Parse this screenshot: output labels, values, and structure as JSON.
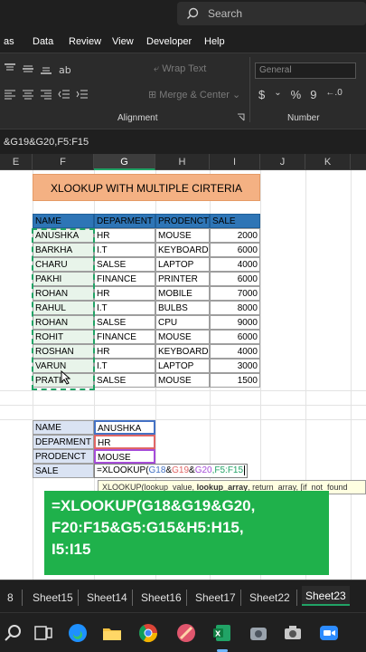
{
  "titlebar": {
    "search_placeholder": "Search"
  },
  "menu": [
    "as",
    "Data",
    "Review",
    "View",
    "Developer",
    "Help"
  ],
  "ribbon": {
    "wrap_text": "Wrap Text",
    "merge_center": "Merge & Center",
    "number_format": "General",
    "alignment_label": "Alignment",
    "number_label": "Number"
  },
  "formula_bar": {
    "text": "&G19&G20,F5:F15"
  },
  "columns": [
    "E",
    "F",
    "G",
    "H",
    "I",
    "J",
    "K"
  ],
  "active_column": "G",
  "sheet": {
    "title": "XLOOKUP WITH MULTIPLE CIRTERIA",
    "headers": [
      "NAME",
      "DEPARMENT",
      "PRODENCT",
      "SALE"
    ],
    "rows": [
      [
        "ANUSHKA",
        "HR",
        "MOUSE",
        "2000"
      ],
      [
        "BARKHA",
        "I.T",
        "KEYBOARD",
        "6000"
      ],
      [
        "CHARU",
        "SALSE",
        "LAPTOP",
        "4000"
      ],
      [
        "PAKHI",
        "FINANCE",
        "PRINTER",
        "6000"
      ],
      [
        "ROHAN",
        "HR",
        "MOBILE",
        "7000"
      ],
      [
        "RAHUL",
        "I.T",
        "BULBS",
        "8000"
      ],
      [
        "ROHAN",
        "SALSE",
        "CPU",
        "9000"
      ],
      [
        "ROHIT",
        "FINANCE",
        "MOUSE",
        "6000"
      ],
      [
        "ROSHAN",
        "HR",
        "KEYBOARD",
        "4000"
      ],
      [
        "VARUN",
        "I.T",
        "LAPTOP",
        "3000"
      ],
      [
        "PRATIK",
        "SALSE",
        "MOUSE",
        "1500"
      ]
    ],
    "lookup": {
      "labels": [
        "NAME",
        "DEPARMENT",
        "PRODENCT",
        "SALE"
      ],
      "values": [
        "ANUSHKA",
        "HR",
        "MOUSE"
      ],
      "formula_prefix": "=XLOOKUP(",
      "formula_ref1": "G18",
      "formula_amp1": "&",
      "formula_ref2": "G19",
      "formula_amp2": "&",
      "formula_ref3": "G20",
      "formula_suffix": ",F5:F15"
    },
    "tooltip": {
      "fn": "XLOOKUP(",
      "arg1": "lookup_value, ",
      "arg2": "lookup_array",
      "rest": ", return_array, [if_not_found"
    }
  },
  "overlay": {
    "line1": "=XLOOKUP(G18&G19&G20,",
    "line2": "F20:F15&G5:G15&H5:H15,",
    "line3": "I5:I15"
  },
  "tabs": [
    "8",
    "Sheet15",
    "Sheet14",
    "Sheet16",
    "Sheet17",
    "Sheet22",
    "Sheet23"
  ],
  "active_tab": "Sheet23",
  "colors": {
    "excel_green": "#21a366",
    "header_blue": "#2e75b6",
    "title_orange": "#f4b183",
    "overlay_green": "#1fb14b"
  }
}
